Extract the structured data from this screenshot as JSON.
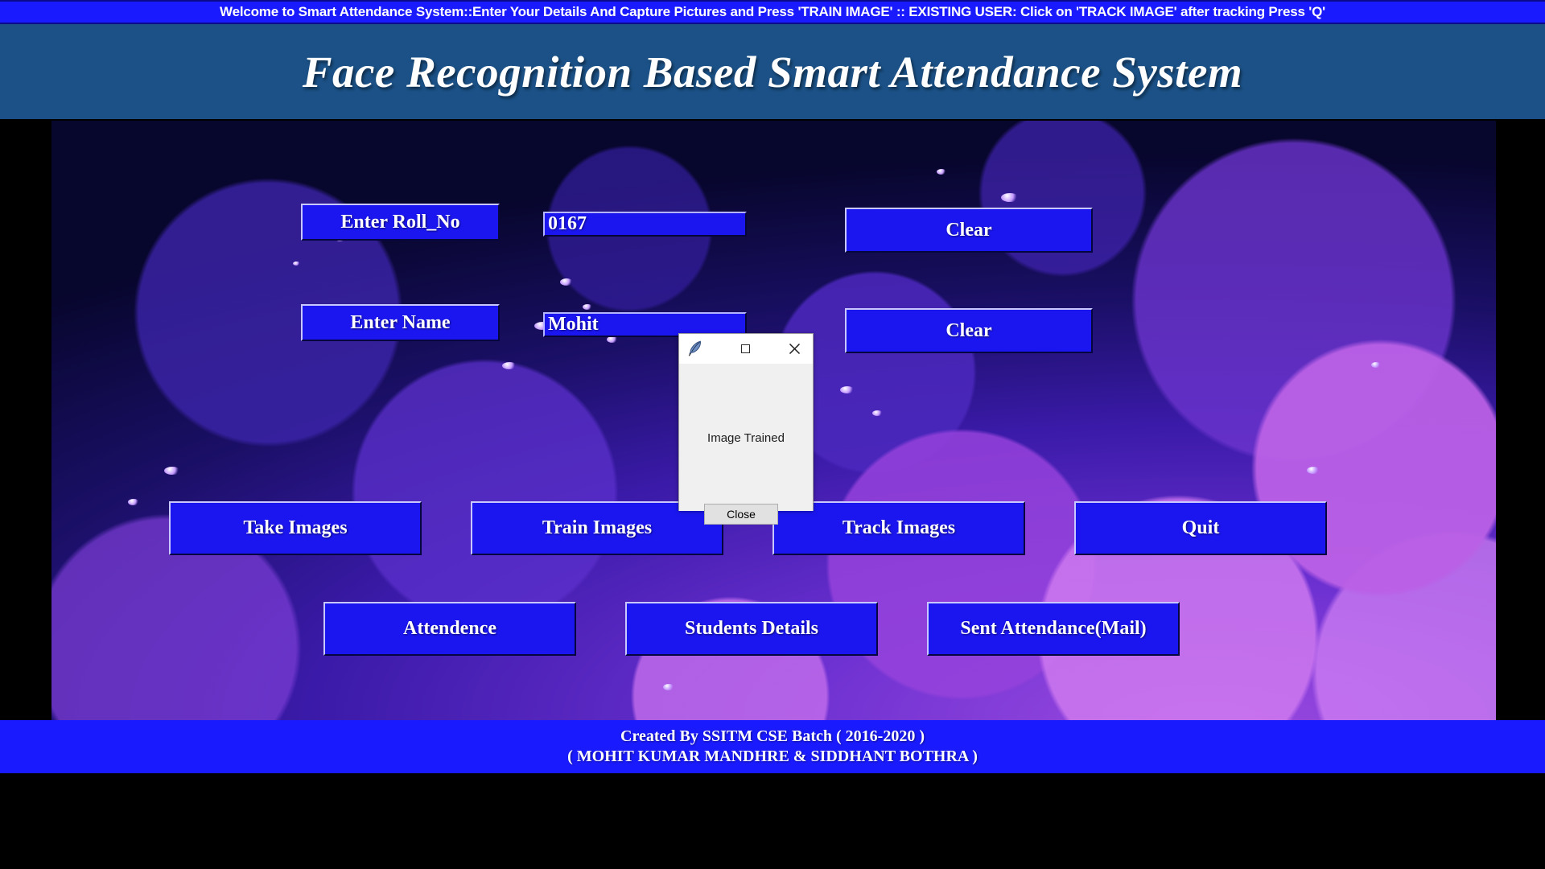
{
  "marquee": {
    "text": "Welcome to Smart Attendance System::Enter Your Details And Capture Pictures and Press 'TRAIN IMAGE' :: EXISTING USER: Click on 'TRACK IMAGE' after tracking Press 'Q'"
  },
  "header": {
    "title": "Face Recognition Based Smart Attendance System"
  },
  "form": {
    "roll_label": "Enter Roll_No",
    "roll_value": "0167",
    "roll_clear_label": "Clear",
    "name_label": "Enter Name",
    "name_value": "Mohit",
    "name_clear_label": "Clear"
  },
  "actions": {
    "take_images": "Take Images",
    "train_images": "Train Images",
    "track_images": "Track Images",
    "quit": "Quit",
    "attendence": "Attendence",
    "students_details": "Students Details",
    "sent_attendance_mail": "Sent Attendance(Mail)"
  },
  "dialog": {
    "message": "Image Trained",
    "close_label": "Close"
  },
  "footer": {
    "line1": "Created By SSITM CSE Batch ( 2016-2020 )",
    "line2": "( MOHIT KUMAR MANDHRE & SIDDHANT BOTHRA )"
  },
  "colors": {
    "marquee_bg": "#1a1aff",
    "header_bg": "#1b5186",
    "button_bg": "#1b16f0",
    "footer_bg": "#1a1aff",
    "dialog_bg": "#f0f0f0",
    "text": "#ffffff"
  }
}
